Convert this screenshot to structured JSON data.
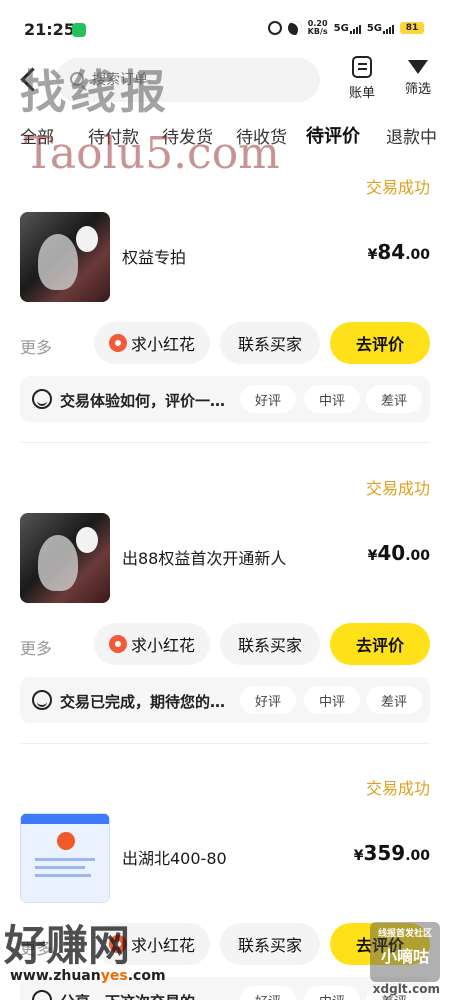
{
  "status_bar": {
    "time": "21:25",
    "net_speed": "0.20",
    "net_unit": "KB/s",
    "signal_1": "5G",
    "signal_2": "5G",
    "battery": "81"
  },
  "header": {
    "search_placeholder": "搜索订单",
    "bill_label": "账单",
    "filter_label": "筛选"
  },
  "tabs": [
    {
      "label": "全部",
      "active": false
    },
    {
      "label": "待付款",
      "active": false
    },
    {
      "label": "待发货",
      "active": false
    },
    {
      "label": "待收货",
      "active": false
    },
    {
      "label": "待评价",
      "active": true
    },
    {
      "label": "退款中",
      "active": false
    }
  ],
  "orders": [
    {
      "status": "交易成功",
      "title": "权益专拍",
      "price_currency": "¥",
      "price_int": "84",
      "price_dec": ".00",
      "more_label": "更多",
      "flower_label": "求小红花",
      "contact_label": "联系买家",
      "review_label": "去评价",
      "feedback_text": "交易体验如何，评价一下吧",
      "rate_good": "好评",
      "rate_mid": "中评",
      "rate_bad": "差评"
    },
    {
      "status": "交易成功",
      "title": "出88权益首次开通新人",
      "price_currency": "¥",
      "price_int": "40",
      "price_dec": ".00",
      "more_label": "更多",
      "flower_label": "求小红花",
      "contact_label": "联系买家",
      "review_label": "去评价",
      "feedback_text": "交易已完成，期待您的评价",
      "rate_good": "好评",
      "rate_mid": "中评",
      "rate_bad": "差评"
    },
    {
      "status": "交易成功",
      "title": "出湖北400-80",
      "price_currency": "¥",
      "price_int": "359",
      "price_dec": ".00",
      "more_label": "更多",
      "flower_label": "求小红花",
      "contact_label": "联系买家",
      "review_label": "去评价",
      "feedback_text": "分享一下这次交易的",
      "rate_good": "好评",
      "rate_mid": "中评",
      "rate_bad": "差评"
    }
  ],
  "watermarks": {
    "top": "找线报",
    "taolu": "Taolu5.com",
    "haozhuan": "好赚网",
    "url_prefix": "www.zhuan",
    "url_accent": "yes",
    "url_suffix": ".com",
    "xiaodiguo_small": "线报首发社区",
    "xiaodiguo_big": "小嘀咕",
    "xdg": "xdglt.com"
  },
  "colors": {
    "accent_yellow": "#ffe11a",
    "status_orange": "#e0a020",
    "flower_red": "#f25b3a"
  }
}
